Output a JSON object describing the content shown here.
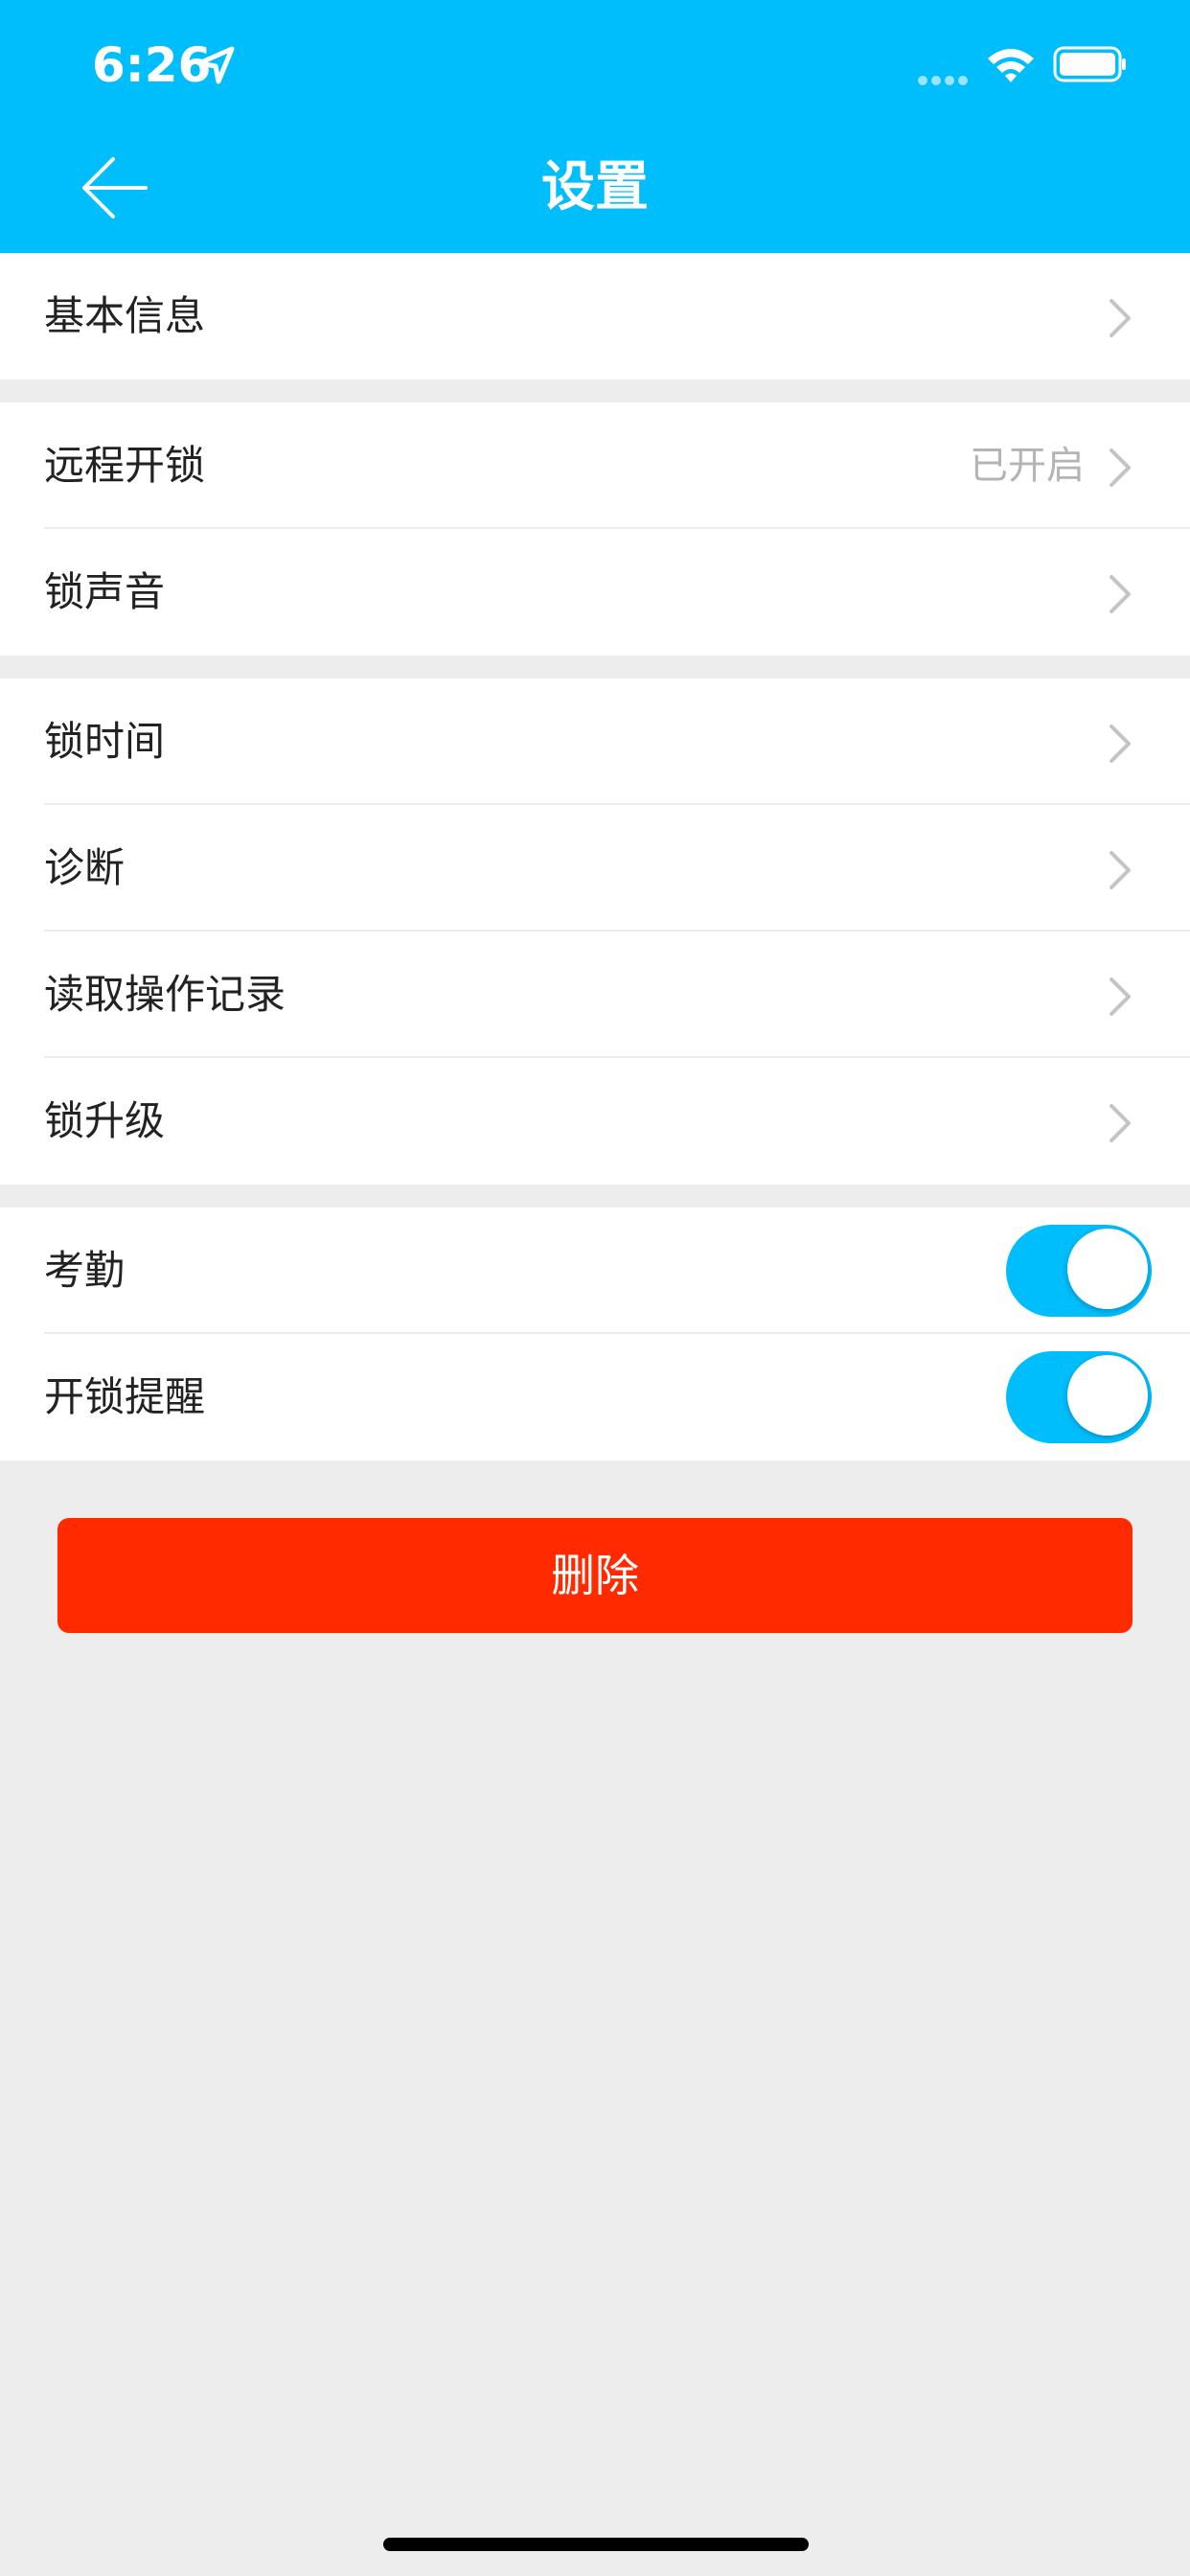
{
  "status_bar": {
    "time": "6:26"
  },
  "header": {
    "title": "设置"
  },
  "groups": [
    {
      "items": [
        {
          "label": "基本信息"
        }
      ]
    },
    {
      "items": [
        {
          "label": "远程开锁",
          "value": "已开启"
        },
        {
          "label": "锁声音"
        }
      ]
    },
    {
      "items": [
        {
          "label": "锁时间"
        },
        {
          "label": "诊断"
        },
        {
          "label": "读取操作记录"
        },
        {
          "label": "锁升级"
        }
      ]
    },
    {
      "items": [
        {
          "label": "考勤",
          "toggle_on": true
        },
        {
          "label": "开锁提醒",
          "toggle_on": true
        }
      ]
    }
  ],
  "actions": {
    "delete_label": "删除"
  },
  "colors": {
    "accent": "#00bdfc",
    "danger": "#ff2a00",
    "background": "#ededed"
  }
}
